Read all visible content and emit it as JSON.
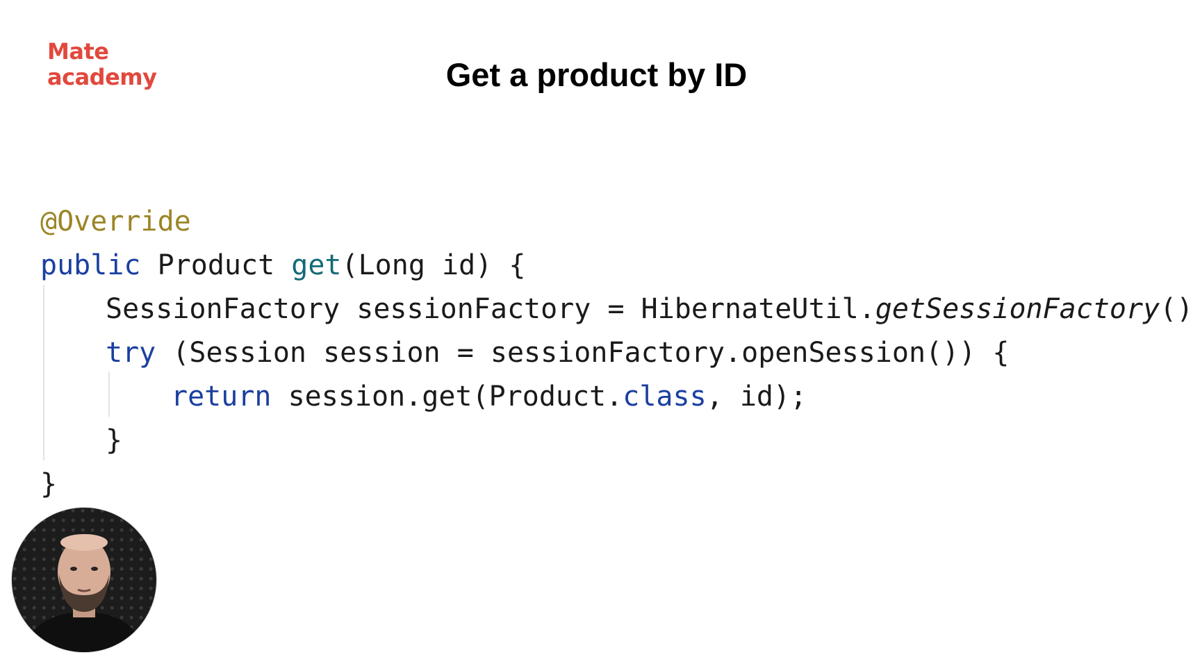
{
  "brand": {
    "line1": "Mate",
    "line2": "academy",
    "color": "#e1493d"
  },
  "slide": {
    "title": "Get a product by ID"
  },
  "code": {
    "line1": {
      "annotation": "@Override"
    },
    "line2": {
      "kw": "public",
      "t1": " Product ",
      "method": "get",
      "t2": "(Long id) {"
    },
    "line3": {
      "t1": "SessionFactory sessionFactory = HibernateUtil.",
      "static_call": "getSessionFactory",
      "t2": "();"
    },
    "line4": {
      "kw": "try",
      "t1": " (Session session = sessionFactory.openSession()) {"
    },
    "line5": {
      "kw": "return",
      "t1": " session.get(Product.",
      "kw2": "class",
      "t2": ", id);"
    },
    "line6": {
      "t1": "}"
    },
    "line7": {
      "t1": "}"
    }
  },
  "colors": {
    "annotation": "#9b8526",
    "keyword": "#1b3fa0",
    "method": "#136a76",
    "text": "#1a1a1a"
  },
  "presenter": {
    "icon": "presenter-webcam-avatar"
  }
}
